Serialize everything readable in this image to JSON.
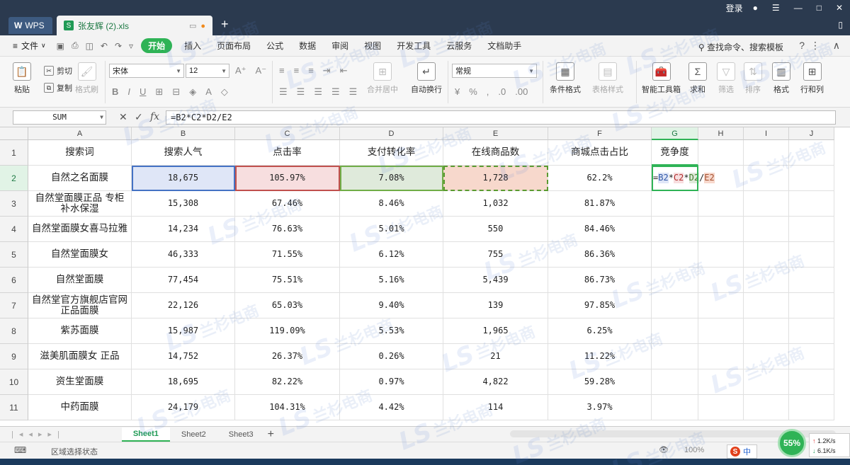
{
  "titlebar": {
    "app_tab": "WPS",
    "file_tab": "张友辉 (2).xls",
    "login": "登录"
  },
  "menu": {
    "file": "文件",
    "items": [
      "开始",
      "插入",
      "页面布局",
      "公式",
      "数据",
      "审阅",
      "视图",
      "开发工具",
      "云服务",
      "文档助手"
    ],
    "active_index": 0,
    "search": "查找命令、搜索模板"
  },
  "ribbon": {
    "paste": "粘贴",
    "cut": "剪切",
    "copy": "复制",
    "format_painter": "格式刷",
    "font_name": "宋体",
    "font_size": "12",
    "merge_center": "合并居中",
    "wrap_text": "自动换行",
    "number_format": "常规",
    "conditional_format": "条件格式",
    "table_style": "表格样式",
    "smart_toolbox": "智能工具箱",
    "sum": "求和",
    "filter": "筛选",
    "sort": "排序",
    "format": "格式",
    "rows_cols": "行和列"
  },
  "formula_bar": {
    "name_box": "SUM",
    "fx": "fx",
    "formula": "=B2*C2*D2/E2"
  },
  "sheet": {
    "columns": [
      "A",
      "B",
      "C",
      "D",
      "E",
      "F",
      "G",
      "H",
      "I",
      "J"
    ],
    "rows": [
      "1",
      "2",
      "3",
      "4",
      "5",
      "6",
      "7",
      "8",
      "9",
      "10",
      "11"
    ],
    "header": [
      "搜索词",
      "搜索人气",
      "点击率",
      "支付转化率",
      "在线商品数",
      "商城点击占比",
      "竞争度"
    ],
    "data": [
      [
        "自然之名面膜",
        "18,675",
        "105.97%",
        "7.08%",
        "1,728",
        "62.2%"
      ],
      [
        "自然堂面膜正品 专柜\n补水保湿",
        "15,308",
        "67.46%",
        "8.46%",
        "1,032",
        "81.87%"
      ],
      [
        "自然堂面膜女喜马拉雅",
        "14,234",
        "76.63%",
        "5.01%",
        "550",
        "84.46%"
      ],
      [
        "自然堂面膜女",
        "46,333",
        "71.55%",
        "6.12%",
        "755",
        "86.36%"
      ],
      [
        "自然堂面膜",
        "77,454",
        "75.51%",
        "5.16%",
        "5,439",
        "86.73%"
      ],
      [
        "自然堂官方旗舰店官网\n正品面膜",
        "22,126",
        "65.03%",
        "9.40%",
        "139",
        "97.85%"
      ],
      [
        "紫苏面膜",
        "15,987",
        "119.09%",
        "5.53%",
        "1,965",
        "6.25%"
      ],
      [
        "滋美肌面膜女 正品",
        "14,752",
        "26.37%",
        "0.26%",
        "21",
        "11.22%"
      ],
      [
        "资生堂面膜",
        "18,695",
        "82.22%",
        "0.97%",
        "4,822",
        "59.28%"
      ],
      [
        "中药面膜",
        "24,179",
        "104.31%",
        "4.42%",
        "114",
        "3.97%"
      ]
    ],
    "edit_cell": {
      "eq": "=",
      "b2": "B2",
      "op1": "*",
      "c2": "C2",
      "op2": "*",
      "d2": "D2",
      "op3": "/",
      "e2": "E2"
    }
  },
  "sheet_tabs": [
    "Sheet1",
    "Sheet2",
    "Sheet3"
  ],
  "status": {
    "mode": "区域选择状态",
    "zoom": "100%"
  },
  "tray": {
    "net_percent": "55%",
    "upload": "1.2K/s",
    "download": "6.1K/s",
    "ime": "中"
  },
  "watermark": {
    "brand": "兰杉电商",
    "logo": "LS"
  }
}
